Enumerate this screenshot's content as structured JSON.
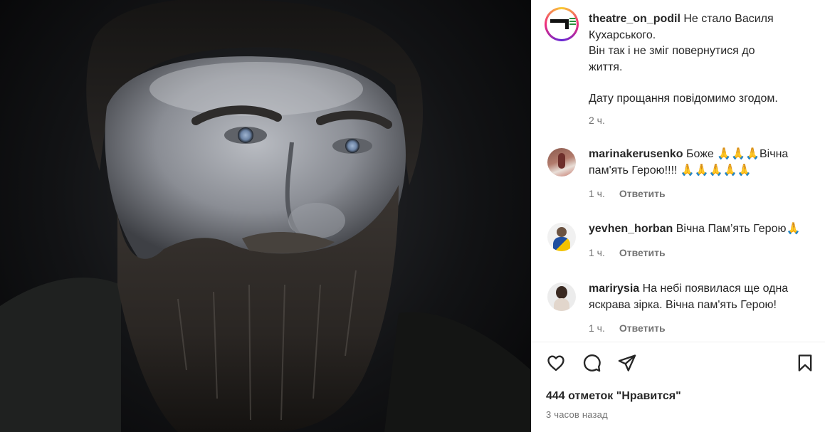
{
  "post": {
    "username": "theatre_on_podil",
    "caption_lines": [
      "Не стало Василя",
      "Кухарського.",
      "Він так і не зміг повернутися до",
      "життя."
    ],
    "caption_after_gap": "Дату прощання повідомимо згодом.",
    "time": "2 ч."
  },
  "comments": [
    {
      "username": "marinakerusenko",
      "text_line1": "Боже 🙏🙏🙏Вічна",
      "text_line2": "пам'ять Герою!!!! 🙏🙏🙏🙏🙏",
      "time": "1 ч.",
      "reply": "Ответить"
    },
    {
      "username": "yevhen_horban",
      "text_line1": "Вічна Пам’ять Герою🙏",
      "time": "1 ч.",
      "reply": "Ответить"
    },
    {
      "username": "marirysia",
      "text_line1": "На небі появилася ще одна",
      "text_line2": "яскрава зірка. Вічна пам'ять Герою!",
      "time": "1 ч.",
      "reply": "Ответить"
    }
  ],
  "actions": {
    "like_icon": "heart-icon",
    "comment_icon": "comment-icon",
    "share_icon": "share-icon",
    "save_icon": "bookmark-icon"
  },
  "likes_text": "444 отметок \"Нравится\"",
  "posted_ago": "3 часов назад",
  "colors": {
    "text": "#262626",
    "secondary": "#737373",
    "divider": "#efefef",
    "photo_bg": "#0b0b0c"
  }
}
